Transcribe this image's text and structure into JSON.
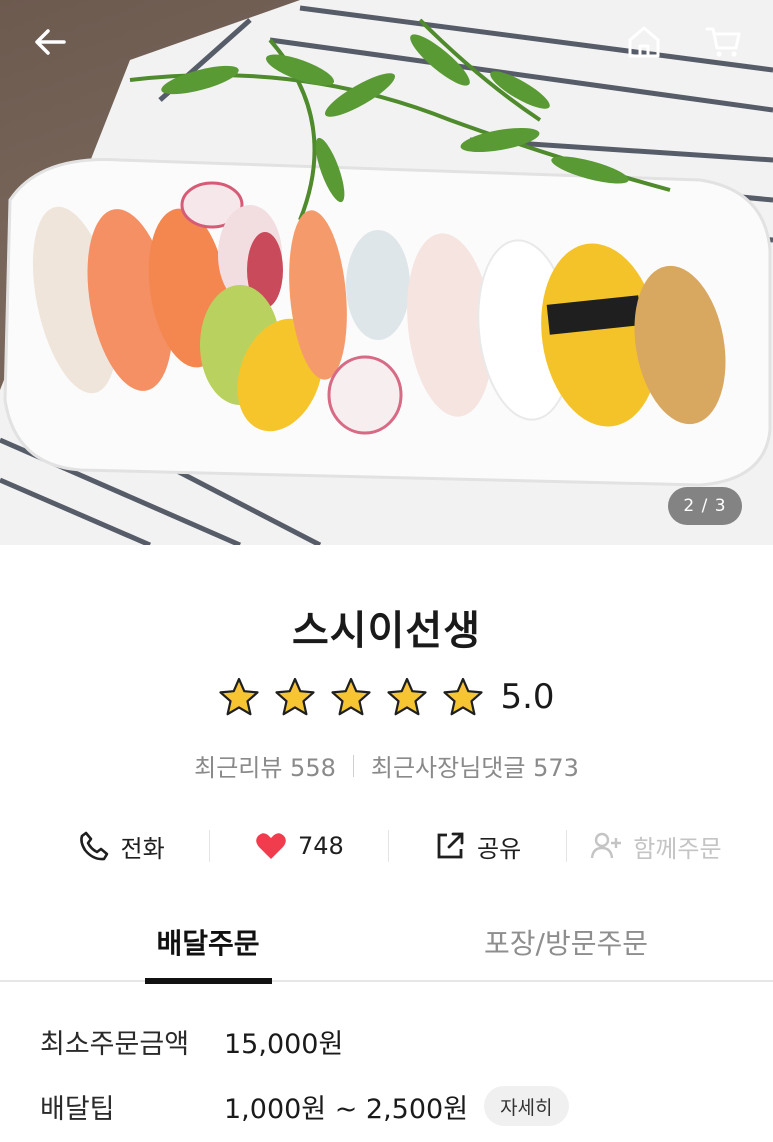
{
  "hero": {
    "image_counter": "2 / 3",
    "back_icon": "arrow-left-icon",
    "home_icon": "home-icon",
    "cart_icon": "cart-icon"
  },
  "store": {
    "name": "스시이선생",
    "rating_value": "5.0",
    "rating_stars": 5,
    "recent_reviews": "최근리뷰 558",
    "owner_replies": "최근사장님댓글 573"
  },
  "actions": {
    "call_label": "전화",
    "like_count": "748",
    "share_label": "공유",
    "group_order_label": "함께주문"
  },
  "tabs": [
    {
      "label": "배달주문",
      "active": true
    },
    {
      "label": "포장/방문주문",
      "active": false
    }
  ],
  "order_info": {
    "min_order_label": "최소주문금액",
    "min_order_value": "15,000원",
    "delivery_tip_label": "배달팁",
    "delivery_tip_value": "1,000원 ~ 2,500원",
    "detail_button": "자세히"
  },
  "colors": {
    "heart": "#f03c4c",
    "star": "#f7c531",
    "tab_underline": "#111111"
  }
}
